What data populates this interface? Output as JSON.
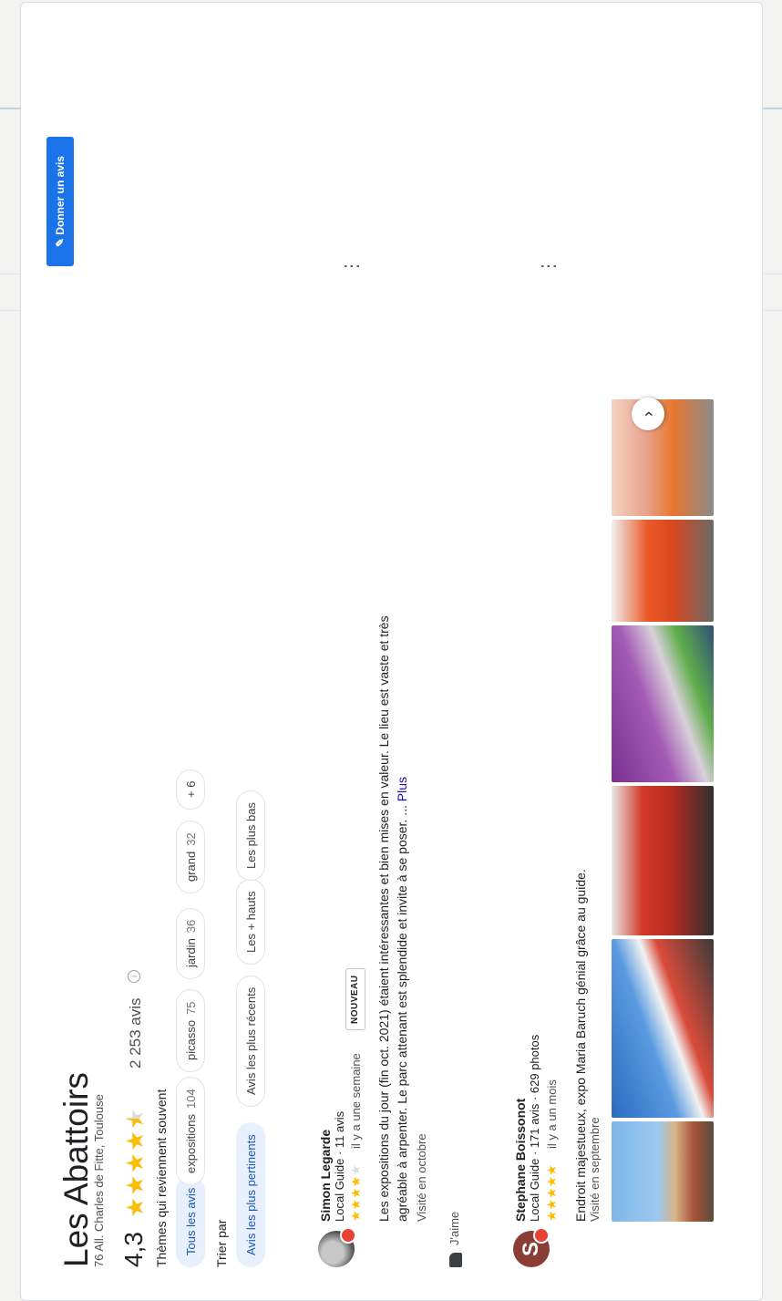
{
  "place": {
    "title": "Les Abattoirs",
    "address": "76 All. Charles de Fitte, Toulouse",
    "rating": "4,3",
    "rating_value": 4.3,
    "reviews_count": "2 253 avis"
  },
  "actions": {
    "write_review": "Donner un avis"
  },
  "themes": {
    "label": "Thèmes qui reviennent souvent",
    "chips": [
      {
        "label": "Tous les avis",
        "count": ""
      },
      {
        "label": "expositions",
        "count": "104"
      },
      {
        "label": "picasso",
        "count": "75"
      },
      {
        "label": "jardin",
        "count": "36"
      },
      {
        "label": "grand",
        "count": "32"
      },
      {
        "label": "+ 6",
        "count": ""
      }
    ]
  },
  "sort": {
    "label": "Trier par",
    "options": [
      "Avis les plus pertinents",
      "Avis les plus récents",
      "Les + hauts",
      "Les plus bas"
    ]
  },
  "reviews": [
    {
      "name": "Simon Legarde",
      "meta": "Local Guide · 11 avis",
      "stars": 4,
      "time": "il y a une semaine",
      "badge": "NOUVEAU",
      "text": "Les expositions du jour (fin oct. 2021) étaient intéressantes et bien mises en valeur. Le lieu est vaste et très agréable à arpenter. Le parc attenant est splendide et invite à se poser. ...",
      "more": "Plus",
      "visited": "Visité en octobre",
      "like": "J'aime"
    },
    {
      "name": "Stephane Boissonot",
      "initial": "S",
      "meta": "Local Guide · 171 avis · 629 photos",
      "stars": 5,
      "time": "il y a un mois",
      "text": "Endroit majestueux, expo Maria Baruch génial grâce au guide.",
      "visited": "Visité en septembre"
    }
  ],
  "colors": {
    "accent": "#1a73e8",
    "star": "#fbbc04",
    "chip_active_bg": "#e8f0fe"
  },
  "icons": [
    "pencil-icon",
    "info-icon",
    "more-vert-icon",
    "thumb-up-icon",
    "local-guide-badge-icon",
    "chevron-right-icon"
  ]
}
